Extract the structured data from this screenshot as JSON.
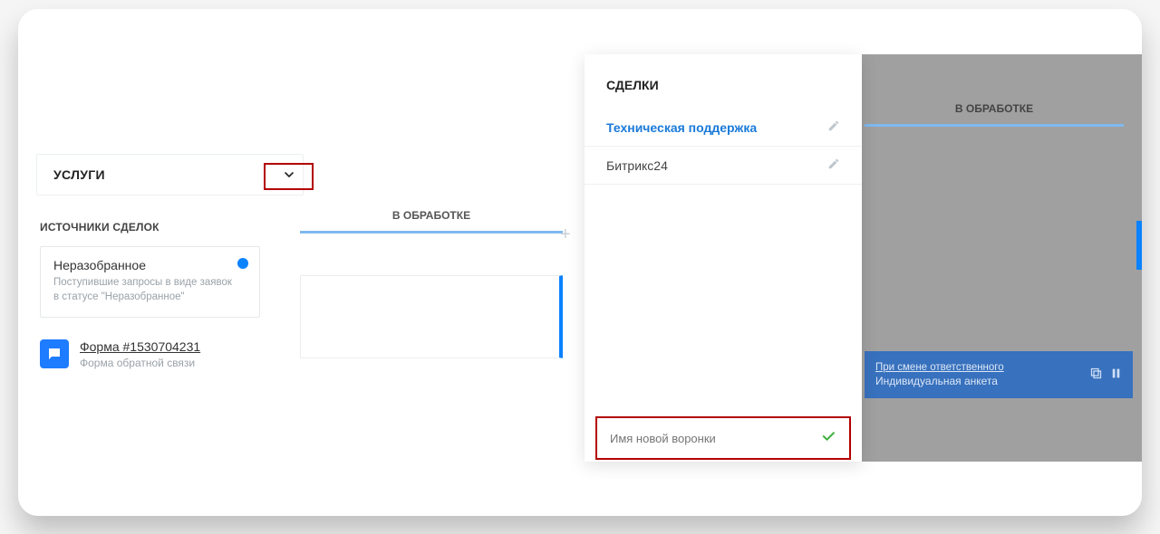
{
  "left": {
    "uslugi_title": "УСЛУГИ",
    "sources_title": "ИСТОЧНИКИ СДЕЛОК",
    "source": {
      "name": "Неразобранное",
      "desc": "Поступившие запросы в виде заявок в статусе \"Неразобранное\""
    },
    "form": {
      "link": "Форма #1530704231",
      "sub": "Форма обратной связи"
    },
    "column_header": "В ОБРАБОТКЕ"
  },
  "right": {
    "column_header": "В ОБРАБОТКЕ",
    "blue_card": {
      "line1": "При смене ответственного",
      "line2": "Индивидуальная анкета"
    }
  },
  "dropdown": {
    "title": "СДЕЛКИ",
    "items": [
      {
        "label": "Техническая поддержка"
      },
      {
        "label": "Битрикс24"
      }
    ],
    "new_placeholder": "Имя новой воронки"
  }
}
